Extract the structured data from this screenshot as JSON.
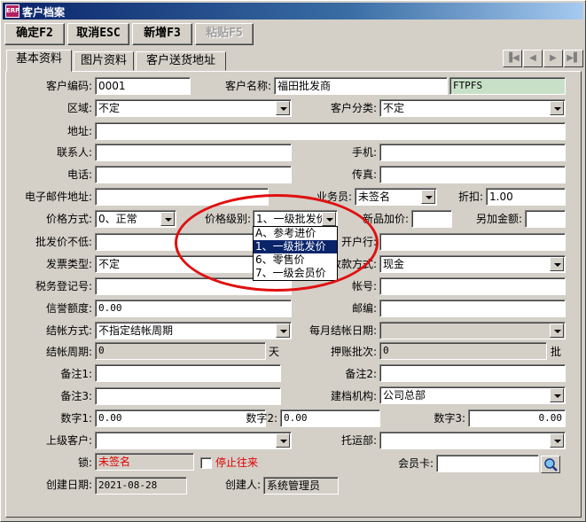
{
  "window": {
    "title": "客户档案",
    "app_icon_text": "ERP"
  },
  "toolbar": {
    "confirm": "确定F2",
    "cancel": "取消ESC",
    "add": "新增F3",
    "paste": "粘贴F5"
  },
  "tabs": [
    "基本资料",
    "图片资料",
    "客户送货地址"
  ],
  "nav": {
    "first": "▐◀",
    "prev": "◀",
    "next": "▶",
    "last": "▶▌"
  },
  "labels": {
    "code": "客户编码:",
    "name": "客户名称:",
    "region": "区域:",
    "category": "客户分类:",
    "address": "地址:",
    "contact": "联系人:",
    "mobile": "手机:",
    "phone": "电话:",
    "fax": "传真:",
    "email": "电子邮件地址:",
    "salesman": "业务员:",
    "discount": "折扣:",
    "price_mode": "价格方式:",
    "price_level": "价格级别:",
    "new_markup": "新品加价:",
    "extra_amount": "另加金额:",
    "wholesale_min": "批发价不低:",
    "bank": "开户行:",
    "invoice_type": "发票类型:",
    "pay_method": "收款方式:",
    "tax_no": "税务登记号:",
    "account_no": "帐号:",
    "credit": "信誉额度:",
    "postcode": "邮编:",
    "settle_mode": "结帐方式:",
    "monthly_settle_date": "每月结帐日期:",
    "settle_period": "结帐周期:",
    "days_unit": "天",
    "overdue_batches": "押账批次:",
    "batch_unit": "批",
    "remark1": "备注1:",
    "remark2": "备注2:",
    "remark3": "备注3:",
    "org": "建档机构:",
    "num1": "数字1:",
    "num2": "数字2:",
    "num3": "数字3:",
    "parent_customer": "上级客户:",
    "shipping_dept": "托运部:",
    "lock": "锁:",
    "stop_trade": "停止往来",
    "member_card": "会员卡:",
    "created_date": "创建日期:",
    "creator": "创建人:"
  },
  "values": {
    "code": "0001",
    "name": "福田批发商",
    "name_code": "FTPFS",
    "region": "不定",
    "category": "不定",
    "address": "",
    "contact": "",
    "mobile": "",
    "phone": "",
    "fax": "",
    "email": "",
    "salesman": "未签名",
    "discount": "1.00",
    "price_mode": "0、正常",
    "price_level": "1、一级批发价",
    "new_markup": "",
    "extra_amount": "",
    "wholesale_min": "",
    "bank": "",
    "invoice_type": "不定",
    "pay_method": "现金",
    "tax_no": "",
    "account_no": "",
    "credit": "0.00",
    "postcode": "",
    "settle_mode": "不指定结帐周期",
    "monthly_settle_date": "",
    "settle_period": "0",
    "overdue_batches": "0",
    "remark1": "",
    "remark2": "",
    "remark3": "",
    "org": "公司总部",
    "num1": "0.00",
    "num2": "0.00",
    "num3": "0.00",
    "parent_customer": "",
    "shipping_dept": "",
    "lock": "未签名",
    "member_card": "",
    "created_date": "2021-08-28",
    "creator": "系统管理员"
  },
  "price_level_options": [
    "A、参考进价",
    "1、一级批发价",
    "6、零售价",
    "7、一级会员价"
  ],
  "price_level_selected_index": 1,
  "colors": {
    "annotation": "#e01010",
    "selection": "#0a246a",
    "name_code_bg": "#c8e0c8",
    "lock_text": "#e00000"
  }
}
